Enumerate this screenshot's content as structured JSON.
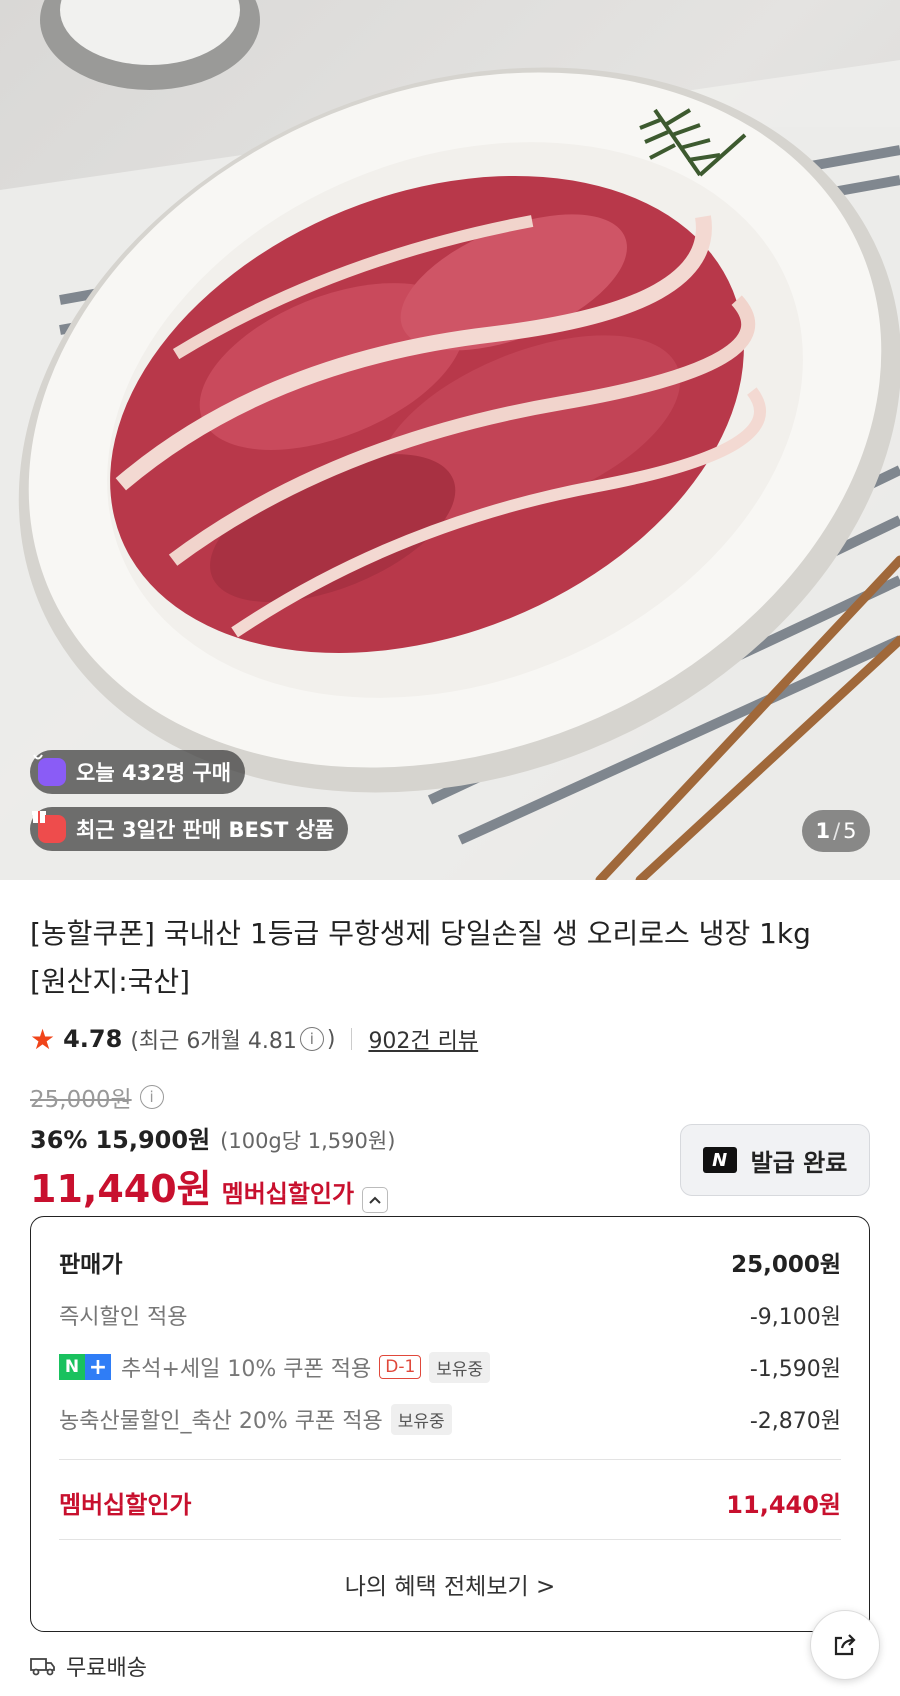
{
  "hero": {
    "today_purchases": "오늘 432명 구매",
    "best_badge": "최근 3일간 판매 BEST 상품",
    "pager_current": "1",
    "pager_separator": "/",
    "pager_total": "5"
  },
  "product": {
    "title_line1": "[농할쿠폰] 국내산 1등급 무항생제 당일손질 생 오리로스 냉장 1kg",
    "title_line2": "[원산지:국산]",
    "rating_score": "4.78",
    "rating_recent": "(최근 6개월 4.81",
    "rating_recent_close": ")",
    "info_glyph": "i",
    "review_count": "902건 리뷰",
    "original_price": "25,000원",
    "discount_pct": "36%",
    "sale_price": "15,900원",
    "unit_price": "(100g당 1,590원)",
    "member_price": "11,440원",
    "member_label": "멤버십할인가",
    "coupon_issued": "발급 완료",
    "coupon_logo": "N"
  },
  "breakdown": {
    "rows": [
      {
        "label": "판매가",
        "value": "25,000원"
      },
      {
        "label": "즉시할인 적용",
        "value": "-9,100원"
      },
      {
        "label": "추석+세일 10% 쿠폰 적용",
        "value": "-1,590원",
        "tag_d": "D-1",
        "tag_hold": "보유중"
      },
      {
        "label": "농축산물할인_축산 20% 쿠폰 적용",
        "value": "-2,870원",
        "tag_hold": "보유중"
      }
    ],
    "total_label": "멤버십할인가",
    "total_value": "11,440원",
    "view_all": "나의 혜택 전체보기 >",
    "np_n": "N",
    "np_plus": "+"
  },
  "delivery": {
    "label": "무료배송"
  },
  "colors": {
    "accent_red": "#c8102e",
    "star": "#f0441a",
    "naver_green": "#19c15e",
    "plus_blue": "#2f7df6"
  },
  "icons": [
    "purchase-bag-icon",
    "gift-icon",
    "star-icon",
    "info-icon",
    "chevron-up-icon",
    "naver-logo-icon",
    "share-icon",
    "truck-icon"
  ]
}
